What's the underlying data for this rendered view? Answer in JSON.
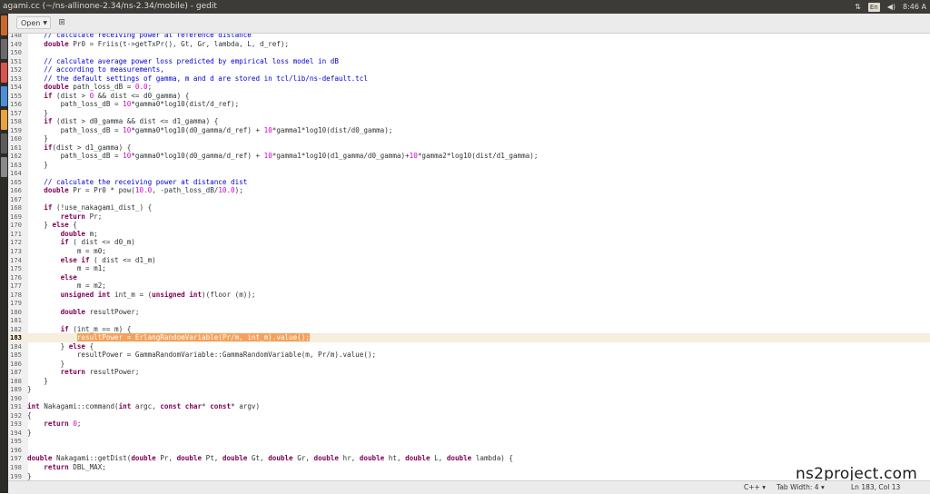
{
  "window": {
    "title": "agami.cc (~/ns-allinone-2.34/ns-2.34/mobile) - gedit"
  },
  "tray": {
    "network_icon": "updown-arrows-icon",
    "keyboard_label": "En",
    "volume_icon": "speaker-icon",
    "time": "8:46 A"
  },
  "toolbar": {
    "open_label": "Open",
    "open_icon": "chevron-down-icon",
    "newdoc_icon": "new-document-icon"
  },
  "editor": {
    "current_line": 183,
    "lines": [
      {
        "n": "148",
        "t": [
          [
            "c",
            "    // calculate receiving power at reference distance"
          ]
        ]
      },
      {
        "n": "149",
        "t": [
          [
            "p",
            "    "
          ],
          [
            "k",
            "double"
          ],
          [
            "p",
            " Pr0 = Friis(t->getTxPr(), Gt, Gr, lambda, L, d_ref);"
          ]
        ]
      },
      {
        "n": "150",
        "t": []
      },
      {
        "n": "151",
        "t": [
          [
            "c",
            "    // calculate average power loss predicted by empirical loss model in dB"
          ]
        ]
      },
      {
        "n": "152",
        "t": [
          [
            "c",
            "    // according to measurements,"
          ]
        ]
      },
      {
        "n": "153",
        "t": [
          [
            "c",
            "    // the default settings of gamma, m and d are stored in tcl/lib/ns-default.tcl"
          ]
        ]
      },
      {
        "n": "154",
        "t": [
          [
            "p",
            "    "
          ],
          [
            "k",
            "double"
          ],
          [
            "p",
            " path_loss_dB = "
          ],
          [
            "n",
            "0.0"
          ],
          [
            "p",
            ";"
          ]
        ]
      },
      {
        "n": "155",
        "t": [
          [
            "p",
            "    "
          ],
          [
            "k",
            "if"
          ],
          [
            "p",
            " (dist > "
          ],
          [
            "n",
            "0"
          ],
          [
            "p",
            " && dist <= d0_gamma) {"
          ]
        ]
      },
      {
        "n": "156",
        "t": [
          [
            "p",
            "        path_loss_dB = "
          ],
          [
            "n",
            "10"
          ],
          [
            "p",
            "*gamma0*log10(dist/d_ref);"
          ]
        ]
      },
      {
        "n": "157",
        "t": [
          [
            "p",
            "    }"
          ]
        ]
      },
      {
        "n": "158",
        "t": [
          [
            "p",
            "    "
          ],
          [
            "k",
            "if"
          ],
          [
            "p",
            " (dist > d0_gamma && dist <= d1_gamma) {"
          ]
        ]
      },
      {
        "n": "159",
        "t": [
          [
            "p",
            "        path_loss_dB = "
          ],
          [
            "n",
            "10"
          ],
          [
            "p",
            "*gamma0*log10(d0_gamma/d_ref) + "
          ],
          [
            "n",
            "10"
          ],
          [
            "p",
            "*gamma1*log10(dist/d0_gamma);"
          ]
        ]
      },
      {
        "n": "160",
        "t": [
          [
            "p",
            "    }"
          ]
        ]
      },
      {
        "n": "161",
        "t": [
          [
            "p",
            "    "
          ],
          [
            "k",
            "if"
          ],
          [
            "p",
            "(dist > d1_gamma) {"
          ]
        ]
      },
      {
        "n": "162",
        "t": [
          [
            "p",
            "        path_loss_dB = "
          ],
          [
            "n",
            "10"
          ],
          [
            "p",
            "*gamma0*log10(d0_gamma/d_ref) + "
          ],
          [
            "n",
            "10"
          ],
          [
            "p",
            "*gamma1*log10(d1_gamma/d0_gamma)+"
          ],
          [
            "n",
            "10"
          ],
          [
            "p",
            "*gamma2*log10(dist/d1_gamma);"
          ]
        ]
      },
      {
        "n": "163",
        "t": [
          [
            "p",
            "    }"
          ]
        ]
      },
      {
        "n": "164",
        "t": []
      },
      {
        "n": "165",
        "t": [
          [
            "c",
            "    // calculate the receiving power at distance dist"
          ]
        ]
      },
      {
        "n": "166",
        "t": [
          [
            "p",
            "    "
          ],
          [
            "k",
            "double"
          ],
          [
            "p",
            " Pr = Pr0 * pow("
          ],
          [
            "n",
            "10.0"
          ],
          [
            "p",
            ", -path_loss_dB/"
          ],
          [
            "n",
            "10.0"
          ],
          [
            "p",
            ");"
          ]
        ]
      },
      {
        "n": "167",
        "t": []
      },
      {
        "n": "168",
        "t": [
          [
            "p",
            "    "
          ],
          [
            "k",
            "if"
          ],
          [
            "p",
            " (!use_nakagami_dist_) {"
          ]
        ]
      },
      {
        "n": "169",
        "t": [
          [
            "p",
            "        "
          ],
          [
            "k",
            "return"
          ],
          [
            "p",
            " Pr;"
          ]
        ]
      },
      {
        "n": "170",
        "t": [
          [
            "p",
            "    } "
          ],
          [
            "k",
            "else"
          ],
          [
            "p",
            " {"
          ]
        ]
      },
      {
        "n": "171",
        "t": [
          [
            "p",
            "        "
          ],
          [
            "k",
            "double"
          ],
          [
            "p",
            " m;"
          ]
        ]
      },
      {
        "n": "172",
        "t": [
          [
            "p",
            "        "
          ],
          [
            "k",
            "if"
          ],
          [
            "p",
            " ( dist <= d0_m)"
          ]
        ]
      },
      {
        "n": "173",
        "t": [
          [
            "p",
            "            m = m0;"
          ]
        ]
      },
      {
        "n": "174",
        "t": [
          [
            "p",
            "        "
          ],
          [
            "k",
            "else if"
          ],
          [
            "p",
            " ( dist <= d1_m)"
          ]
        ]
      },
      {
        "n": "175",
        "t": [
          [
            "p",
            "            m = m1;"
          ]
        ]
      },
      {
        "n": "176",
        "t": [
          [
            "p",
            "        "
          ],
          [
            "k",
            "else"
          ]
        ]
      },
      {
        "n": "177",
        "t": [
          [
            "p",
            "            m = m2;"
          ]
        ]
      },
      {
        "n": "178",
        "t": [
          [
            "p",
            "        "
          ],
          [
            "k",
            "unsigned int"
          ],
          [
            "p",
            " int_m = ("
          ],
          [
            "k",
            "unsigned int"
          ],
          [
            "p",
            ")(floor (m));"
          ]
        ]
      },
      {
        "n": "179",
        "t": []
      },
      {
        "n": "180",
        "t": [
          [
            "p",
            "        "
          ],
          [
            "k",
            "double"
          ],
          [
            "p",
            " resultPower;"
          ]
        ]
      },
      {
        "n": "181",
        "t": []
      },
      {
        "n": "182",
        "t": [
          [
            "p",
            "        "
          ],
          [
            "k",
            "if"
          ],
          [
            "p",
            " (int_m == m) {"
          ]
        ]
      },
      {
        "n": "183",
        "t": [
          [
            "p",
            "            "
          ],
          [
            "s",
            "resultPower = ErlangRandomVariable(Pr/m, int_m).value();"
          ]
        ]
      },
      {
        "n": "184",
        "t": [
          [
            "p",
            "        } "
          ],
          [
            "k",
            "else"
          ],
          [
            "p",
            " {"
          ]
        ]
      },
      {
        "n": "185",
        "t": [
          [
            "p",
            "            resultPower = GammaRandomVariable::GammaRandomVariable(m, Pr/m).value();"
          ]
        ]
      },
      {
        "n": "186",
        "t": [
          [
            "p",
            "        }"
          ]
        ]
      },
      {
        "n": "187",
        "t": [
          [
            "p",
            "        "
          ],
          [
            "k",
            "return"
          ],
          [
            "p",
            " resultPower;"
          ]
        ]
      },
      {
        "n": "188",
        "t": [
          [
            "p",
            "    }"
          ]
        ]
      },
      {
        "n": "189",
        "t": [
          [
            "p",
            "}"
          ]
        ]
      },
      {
        "n": "190",
        "t": []
      },
      {
        "n": "191",
        "t": [
          [
            "k",
            "int"
          ],
          [
            "p",
            " Nakagami::command("
          ],
          [
            "k",
            "int"
          ],
          [
            "p",
            " argc, "
          ],
          [
            "k",
            "const char"
          ],
          [
            "p",
            "* "
          ],
          [
            "k",
            "const"
          ],
          [
            "p",
            "* argv)"
          ]
        ]
      },
      {
        "n": "192",
        "t": [
          [
            "p",
            "{"
          ]
        ]
      },
      {
        "n": "193",
        "t": [
          [
            "p",
            "    "
          ],
          [
            "k",
            "return"
          ],
          [
            "p",
            " "
          ],
          [
            "n",
            "0"
          ],
          [
            "p",
            ";"
          ]
        ]
      },
      {
        "n": "194",
        "t": [
          [
            "p",
            "}"
          ]
        ]
      },
      {
        "n": "195",
        "t": []
      },
      {
        "n": "196",
        "t": []
      },
      {
        "n": "197",
        "t": [
          [
            "k",
            "double"
          ],
          [
            "p",
            " Nakagami::getDist("
          ],
          [
            "k",
            "double"
          ],
          [
            "p",
            " Pr, "
          ],
          [
            "k",
            "double"
          ],
          [
            "p",
            " Pt, "
          ],
          [
            "k",
            "double"
          ],
          [
            "p",
            " Gt, "
          ],
          [
            "k",
            "double"
          ],
          [
            "p",
            " Gr, "
          ],
          [
            "k",
            "double"
          ],
          [
            "p",
            " hr, "
          ],
          [
            "k",
            "double"
          ],
          [
            "p",
            " ht, "
          ],
          [
            "k",
            "double"
          ],
          [
            "p",
            " L, "
          ],
          [
            "k",
            "double"
          ],
          [
            "p",
            " lambda) {"
          ]
        ]
      },
      {
        "n": "198",
        "t": [
          [
            "p",
            "    "
          ],
          [
            "k",
            "return"
          ],
          [
            "p",
            " DBL_MAX;"
          ]
        ]
      },
      {
        "n": "199",
        "t": [
          [
            "p",
            "}"
          ]
        ]
      }
    ]
  },
  "statusbar": {
    "language": "C++",
    "language_icon": "chevron-down-icon",
    "tab_width": "Tab Width: 4",
    "tab_icon": "chevron-down-icon",
    "position": "Ln 183, Col 13"
  },
  "watermark": "ns2project.com",
  "colors": {
    "comment": "#0000d5",
    "keyword": "#7f0055",
    "number": "#d000d0",
    "selection": "#f5a05a",
    "current_line": "#f6eedc"
  }
}
